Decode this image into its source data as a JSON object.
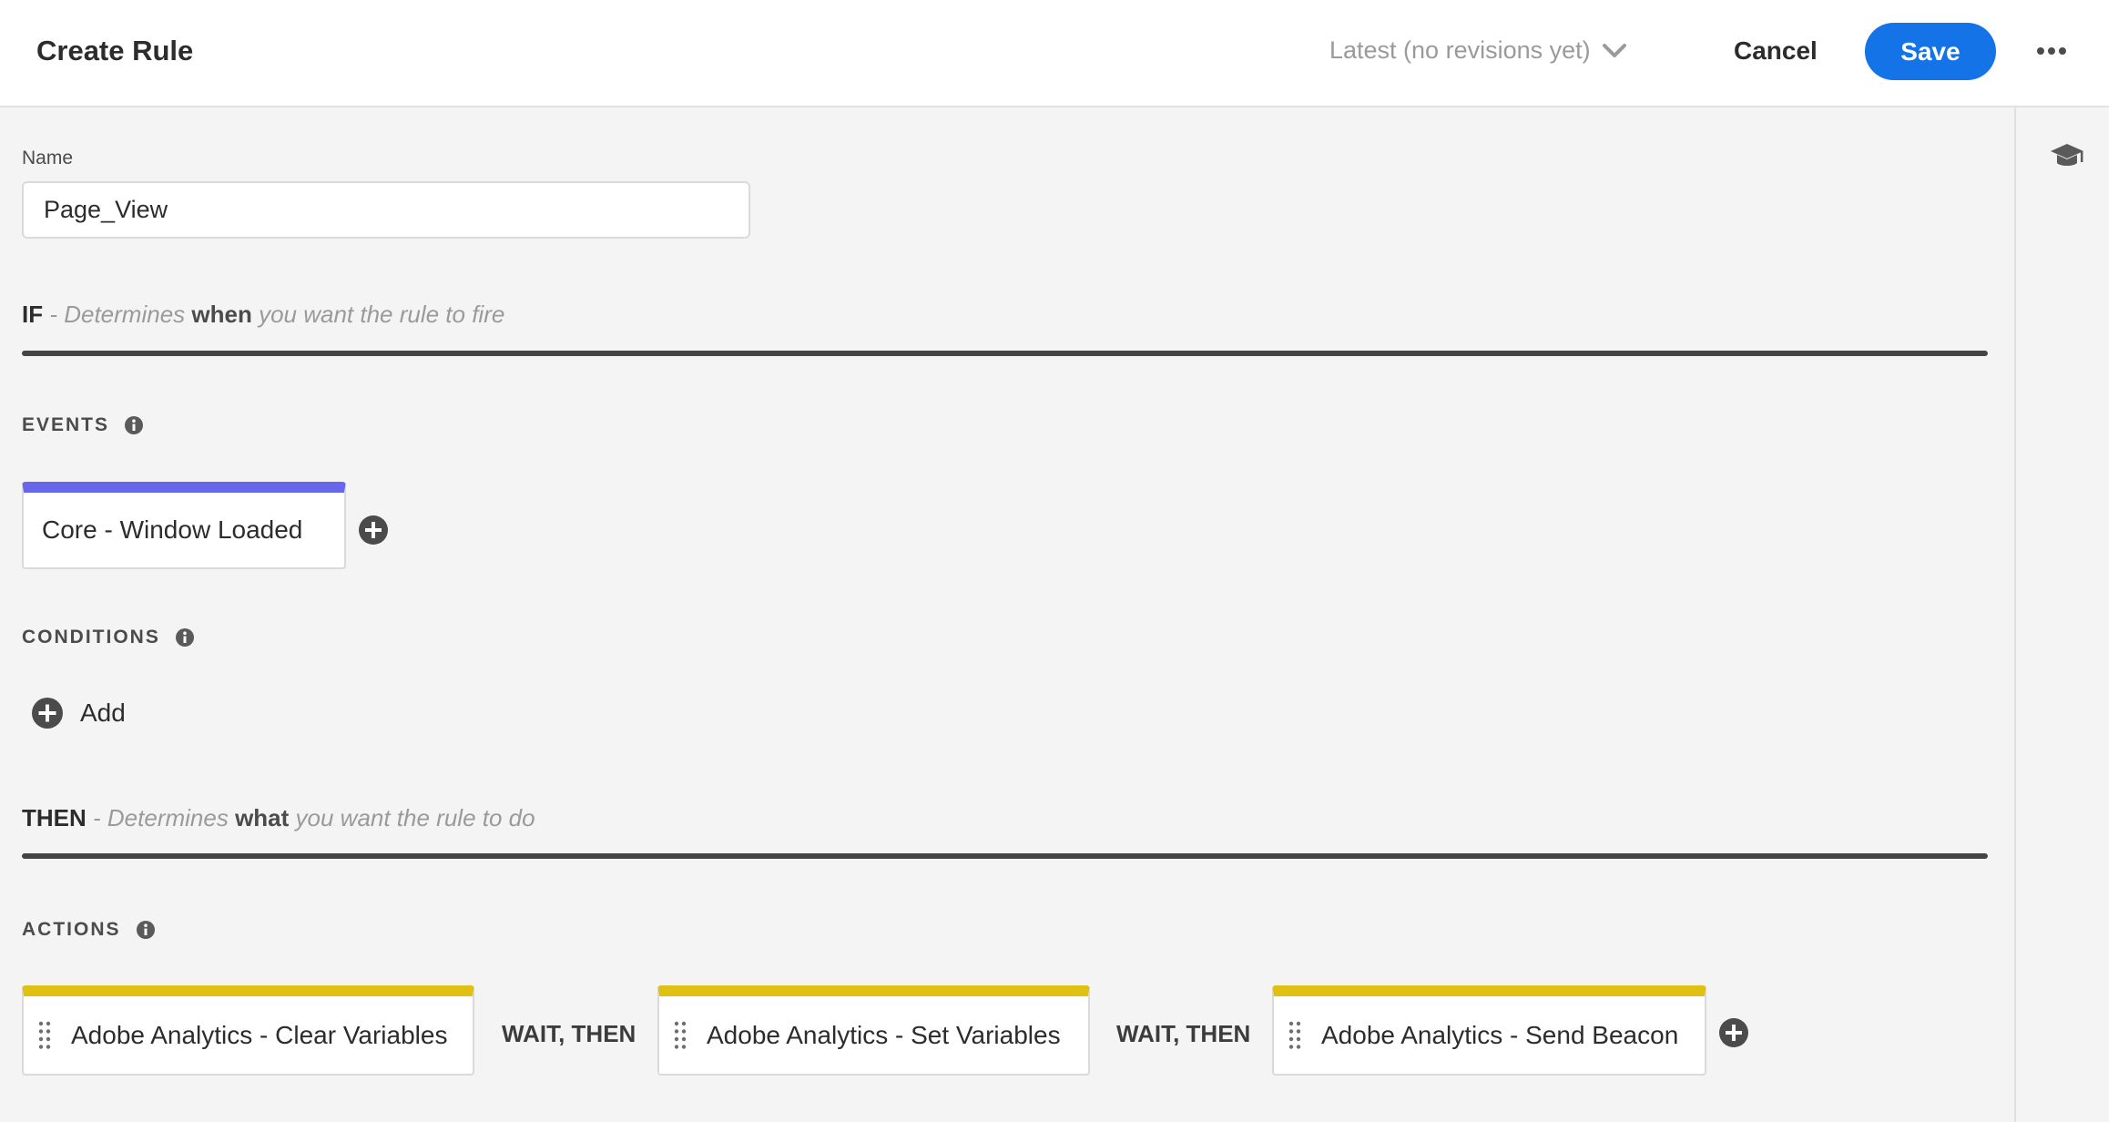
{
  "header": {
    "title": "Create Rule",
    "revision_label": "Latest (no revisions yet)",
    "cancel_label": "Cancel",
    "save_label": "Save"
  },
  "rail": {
    "icon": "graduation-cap-icon"
  },
  "name_field": {
    "label": "Name",
    "value": "Page_View"
  },
  "if_section": {
    "keyword": "IF",
    "desc_pre": "- Determines ",
    "desc_emphasis": "when",
    "desc_post": " you want the rule to fire"
  },
  "events": {
    "label": "EVENTS",
    "items": [
      {
        "label": "Core - Window Loaded"
      }
    ]
  },
  "conditions": {
    "label": "CONDITIONS",
    "add_label": "Add"
  },
  "then_section": {
    "keyword": "THEN",
    "desc_pre": "- Determines ",
    "desc_emphasis": "what",
    "desc_post": " you want the rule to do"
  },
  "actions": {
    "label": "ACTIONS",
    "separator_label": "WAIT, THEN",
    "items": [
      {
        "label": "Adobe Analytics - Clear Variables"
      },
      {
        "label": "Adobe Analytics - Set Variables"
      },
      {
        "label": "Adobe Analytics - Send Beacon"
      }
    ]
  },
  "colors": {
    "primary_button": "#1473e6",
    "event_accent": "#6767ec",
    "action_accent": "#e0c013"
  }
}
